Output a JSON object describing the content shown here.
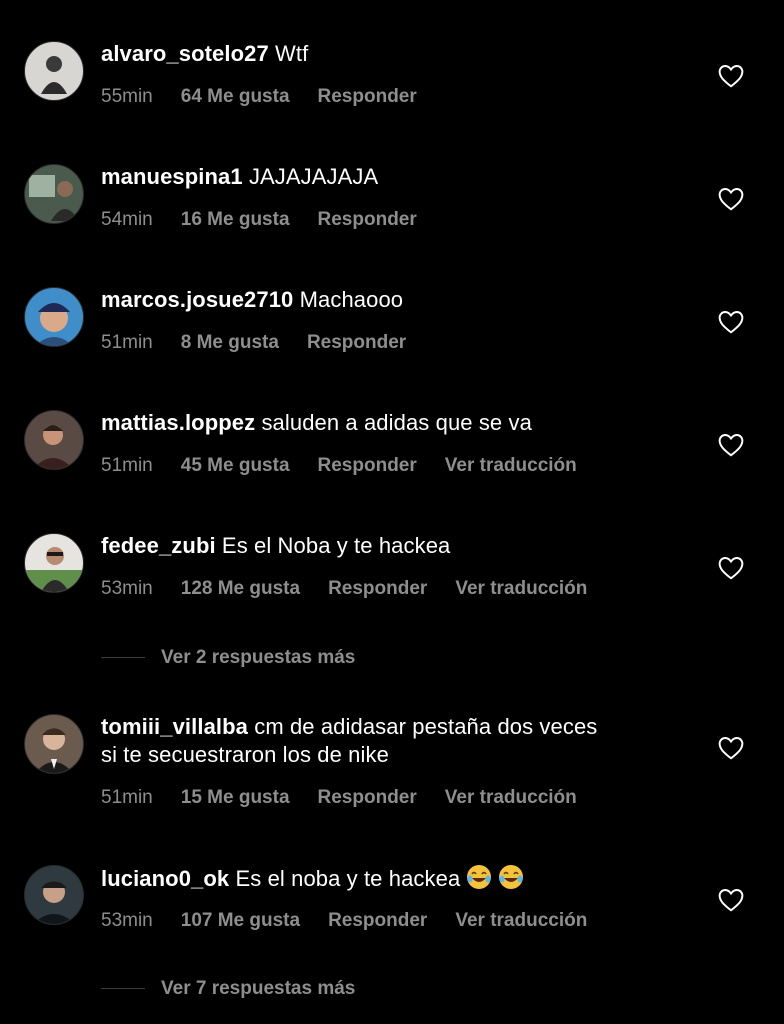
{
  "comments": [
    {
      "username": "alvaro_sotelo27",
      "text": "Wtf",
      "time": "55min",
      "likes": "64 Me gusta",
      "reply": "Responder",
      "avatar_color": "#d8d6d2",
      "avatar_icon": "person-icon"
    },
    {
      "username": "manuespina1",
      "text": "JAJAJAJAJA",
      "time": "54min",
      "likes": "16 Me gusta",
      "reply": "Responder",
      "avatar_color": "#4a5a4c",
      "avatar_icon": "person-icon"
    },
    {
      "username": "marcos.josue2710",
      "text": "Machaooo",
      "time": "51min",
      "likes": "8 Me gusta",
      "reply": "Responder",
      "avatar_color": "#3f8ec9",
      "avatar_icon": "person-icon"
    },
    {
      "username": "mattias.loppez",
      "text": "saluden a adidas que se va",
      "time": "51min",
      "likes": "45 Me gusta",
      "reply": "Responder",
      "translate": "Ver traducción",
      "avatar_color": "#5a4a44",
      "avatar_icon": "person-icon"
    },
    {
      "username": "fedee_zubi",
      "text": "Es el Noba y te hackea",
      "time": "53min",
      "likes": "128 Me gusta",
      "reply": "Responder",
      "translate": "Ver traducción",
      "replies": "Ver 2 respuestas más",
      "avatar_color": "#e6e4e0",
      "avatar_icon": "person-icon"
    },
    {
      "username": "tomiii_villalba",
      "text_line1": "cm de adidasar pestaña dos veces",
      "text_line2": "si te secuestraron los de nike",
      "time": "51min",
      "likes": "15 Me gusta",
      "reply": "Responder",
      "translate": "Ver traducción",
      "avatar_color": "#6b5a4e",
      "avatar_icon": "person-icon"
    },
    {
      "username": "luciano0_ok",
      "text": "Es el noba y te hackea",
      "emoji": "😂😂",
      "time": "53min",
      "likes": "107 Me gusta",
      "reply": "Responder",
      "translate": "Ver traducción",
      "replies": "Ver 7 respuestas más",
      "avatar_color": "#2e3a40",
      "avatar_icon": "person-icon"
    }
  ],
  "icons": {
    "like": "heart-outline-icon",
    "emoji": "laughing-tears-emoji"
  },
  "colors": {
    "background": "#000000",
    "primary_text": "#ffffff",
    "secondary_text": "#8e8e8e"
  }
}
